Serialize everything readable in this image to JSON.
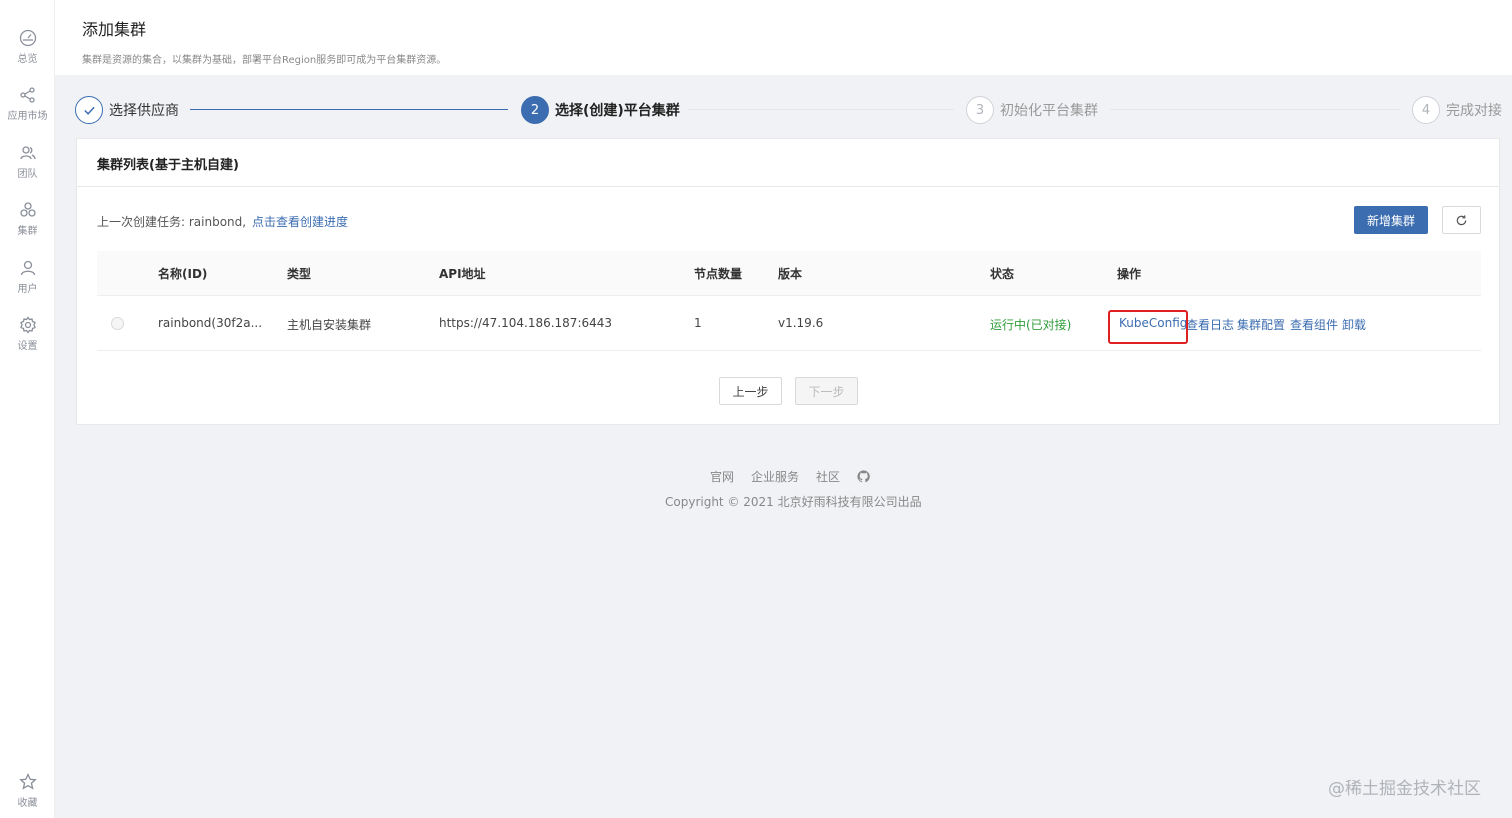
{
  "sidebar": {
    "items": [
      {
        "label": "总览",
        "icon": "dashboard-icon"
      },
      {
        "label": "应用市场",
        "icon": "share-icon"
      },
      {
        "label": "团队",
        "icon": "team-icon"
      },
      {
        "label": "集群",
        "icon": "cluster-icon"
      },
      {
        "label": "用户",
        "icon": "user-icon"
      },
      {
        "label": "设置",
        "icon": "gear-icon"
      }
    ],
    "favorite": {
      "label": "收藏",
      "icon": "star-icon"
    }
  },
  "header": {
    "title": "添加集群",
    "description": "集群是资源的集合，以集群为基础，部署平台Region服务即可成为平台集群资源。"
  },
  "steps": [
    {
      "number": "1",
      "title": "选择供应商",
      "state": "done"
    },
    {
      "number": "2",
      "title": "选择(创建)平台集群",
      "state": "active"
    },
    {
      "number": "3",
      "title": "初始化平台集群",
      "state": "pending"
    },
    {
      "number": "4",
      "title": "完成对接",
      "state": "pending"
    }
  ],
  "card": {
    "title": "集群列表(基于主机自建)",
    "last_task_text": "上一次创建任务: rainbond,",
    "view_progress_link": "点击查看创建进度",
    "add_button": "新增集群"
  },
  "table": {
    "headers": {
      "name": "名称(ID)",
      "type": "类型",
      "api": "API地址",
      "nodes": "节点数量",
      "version": "版本",
      "status": "状态",
      "actions": "操作"
    },
    "rows": [
      {
        "name": "rainbond(30f2a...",
        "type": "主机自安装集群",
        "api": "https://47.104.186.187:6443",
        "nodes": "1",
        "version": "v1.19.6",
        "status": "运行中(已对接)",
        "actions": [
          "KubeConfig",
          "查看日志",
          "集群配置",
          "查看组件",
          "卸载"
        ]
      }
    ]
  },
  "nav_buttons": {
    "prev": "上一步",
    "next": "下一步"
  },
  "footer": {
    "links": [
      "官网",
      "企业服务",
      "社区"
    ],
    "copyright": "Copyright © 2021 北京好雨科技有限公司出品"
  },
  "watermark": "@稀土掘金技术社区",
  "colors": {
    "primary": "#3c6db0",
    "success": "#2f9d3a",
    "highlight": "#e02020"
  }
}
